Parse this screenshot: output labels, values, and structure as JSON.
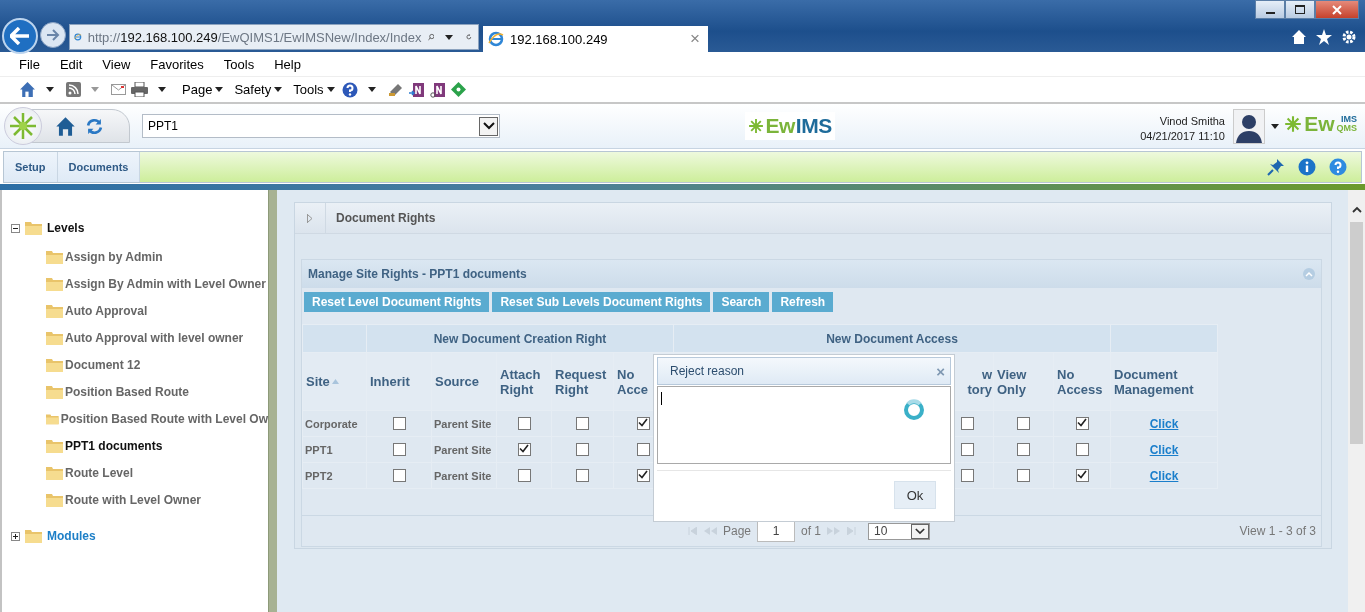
{
  "browser": {
    "address": {
      "scheme": "http://",
      "host": "192.168.100.249",
      "path": "/EwQIMS1/EwIMSNew/Index/Index"
    },
    "tab": {
      "title": "192.168.100.249",
      "close": "×"
    },
    "menu": [
      "File",
      "Edit",
      "View",
      "Favorites",
      "Tools",
      "Help"
    ],
    "toolbar_menus": [
      "Page",
      "Safety",
      "Tools"
    ]
  },
  "app_header": {
    "site_select": {
      "value": "PPT1"
    },
    "logo": {
      "ew": "Ew",
      "ims": "IMS"
    },
    "user": {
      "name": "Vinod Smitha",
      "datetime": "04/21/2017 11:10"
    },
    "brand": {
      "ew": "Ew",
      "top": "IMS",
      "bottom": "QMS"
    }
  },
  "nav_tabs": [
    "Setup",
    "Documents"
  ],
  "tree": [
    {
      "label": "Levels",
      "expanded": true,
      "children": [
        {
          "label": "Assign by Admin",
          "selected": false
        },
        {
          "label": "Assign By Admin with Level Owner",
          "selected": false
        },
        {
          "label": "Auto Approval",
          "selected": false
        },
        {
          "label": "Auto Approval with level owner",
          "selected": false
        },
        {
          "label": "Document 12",
          "selected": false
        },
        {
          "label": "Position Based Route",
          "selected": false
        },
        {
          "label": "Position Based Route with Level Ow",
          "selected": false
        },
        {
          "label": "PPT1 documents",
          "selected": true
        },
        {
          "label": "Route Level",
          "selected": false
        },
        {
          "label": "Route with Level Owner",
          "selected": false
        }
      ]
    },
    {
      "label": "Modules",
      "expanded": false
    }
  ],
  "panel": {
    "title": "Document Rights"
  },
  "grid": {
    "caption": "Manage Site Rights - PPT1 documents",
    "buttons": [
      "Reset Level Document Rights",
      "Reset Sub Levels Document Rights",
      "Search",
      "Refresh"
    ],
    "column_groups": [
      "New Document Creation Right",
      "New Document Access"
    ],
    "columns": [
      "Site",
      "Inherit",
      "Source",
      "Attach Right",
      "Request Right",
      "No Acce",
      "w tory",
      "View Only",
      "No Access",
      "Document Management"
    ],
    "rows": [
      {
        "site": "Corporate",
        "inherit": false,
        "source": "Parent Site",
        "attach_right": false,
        "request_right": false,
        "no_access_create": true,
        "column_7": false,
        "view_only": false,
        "no_access": true,
        "document_management": "Click"
      },
      {
        "site": "PPT1",
        "inherit": false,
        "source": "Parent Site",
        "attach_right": true,
        "request_right": false,
        "no_access_create": false,
        "column_7": false,
        "view_only": false,
        "no_access": false,
        "document_management": "Click"
      },
      {
        "site": "PPT2",
        "inherit": false,
        "source": "Parent Site",
        "attach_right": false,
        "request_right": false,
        "no_access_create": true,
        "column_7": false,
        "view_only": false,
        "no_access": true,
        "document_management": "Click"
      }
    ],
    "pager": {
      "page_label": "Page",
      "page": "1",
      "of": "of 1",
      "page_size": "10",
      "summary": "View 1 - 3 of 3"
    }
  },
  "dialog": {
    "title": "Reject reason",
    "close": "×",
    "ok": "Ok"
  }
}
